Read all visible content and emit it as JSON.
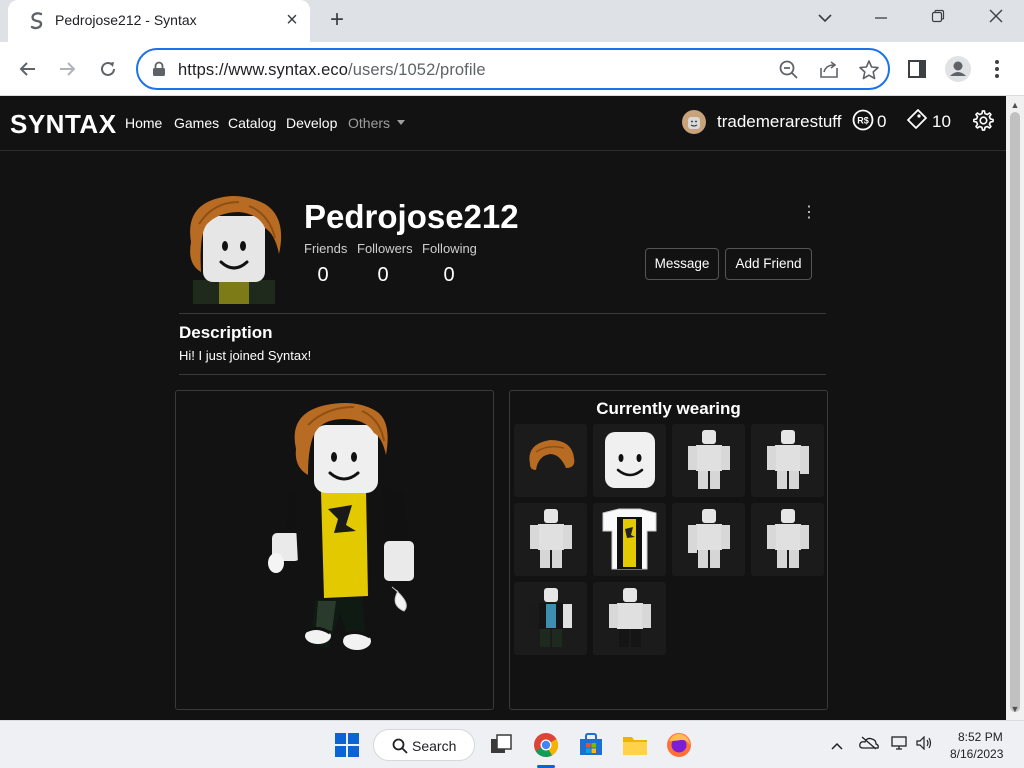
{
  "browser": {
    "tab_title": "Pedrojose212 - Syntax",
    "url_base": "https://www.syntax.eco",
    "url_path": "/users/1052/profile"
  },
  "nav": {
    "logo": "SYNTAX",
    "links": [
      "Home",
      "Games",
      "Catalog",
      "Develop"
    ],
    "others_label": "Others",
    "username": "trademerarestuff",
    "robux": "0",
    "tickets": "10"
  },
  "profile": {
    "username": "Pedrojose212",
    "stats": [
      {
        "label": "Friends",
        "value": "0"
      },
      {
        "label": "Followers",
        "value": "0"
      },
      {
        "label": "Following",
        "value": "0"
      }
    ],
    "message_button": "Message",
    "add_friend_button": "Add Friend",
    "description_title": "Description",
    "description_text": "Hi! I just joined Syntax!",
    "currently_wearing_title": "Currently wearing",
    "wearing_items": [
      "hair",
      "face",
      "body-part",
      "body-part",
      "body-part",
      "shirt",
      "body-part",
      "body-part",
      "outfit",
      "pants"
    ]
  },
  "taskbar": {
    "search_label": "Search",
    "time": "8:52 PM",
    "date": "8/16/2023"
  },
  "colors": {
    "accent": "#1a73e8",
    "page_bg": "#121212",
    "hair": "#b5651d",
    "shirt": "#f2d600"
  }
}
